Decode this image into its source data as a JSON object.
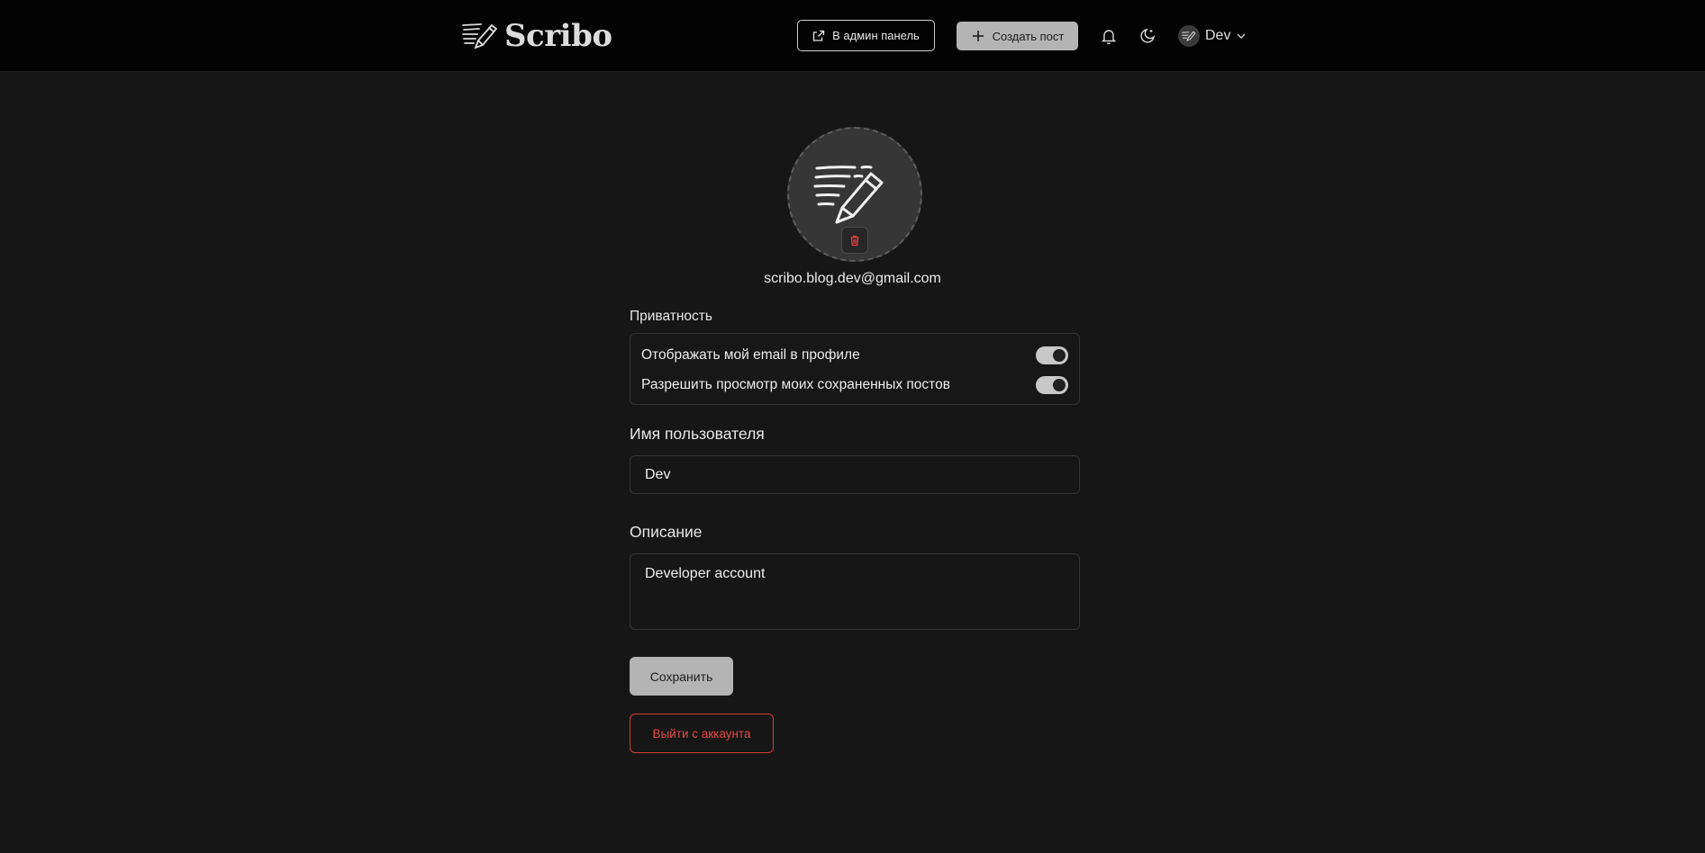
{
  "header": {
    "logo_text": "Scribo",
    "admin_button": "В админ панель",
    "create_button": "Создать пост",
    "user_name": "Dev"
  },
  "profile": {
    "email": "scribo.blog.dev@gmail.com"
  },
  "privacy": {
    "title": "Приватность",
    "options": [
      {
        "label": "Отображать мой email в профиле",
        "enabled": true
      },
      {
        "label": "Разрешить просмотр моих сохраненных постов",
        "enabled": true
      }
    ]
  },
  "username": {
    "label": "Имя пользователя",
    "value": "Dev"
  },
  "description": {
    "label": "Описание",
    "value": "Developer account"
  },
  "actions": {
    "save": "Сохранить",
    "logout": "Выйти с аккаунта"
  },
  "colors": {
    "background": "#161616",
    "header": "#030303",
    "button_light": "#b4b4b4",
    "danger": "#e24848"
  }
}
